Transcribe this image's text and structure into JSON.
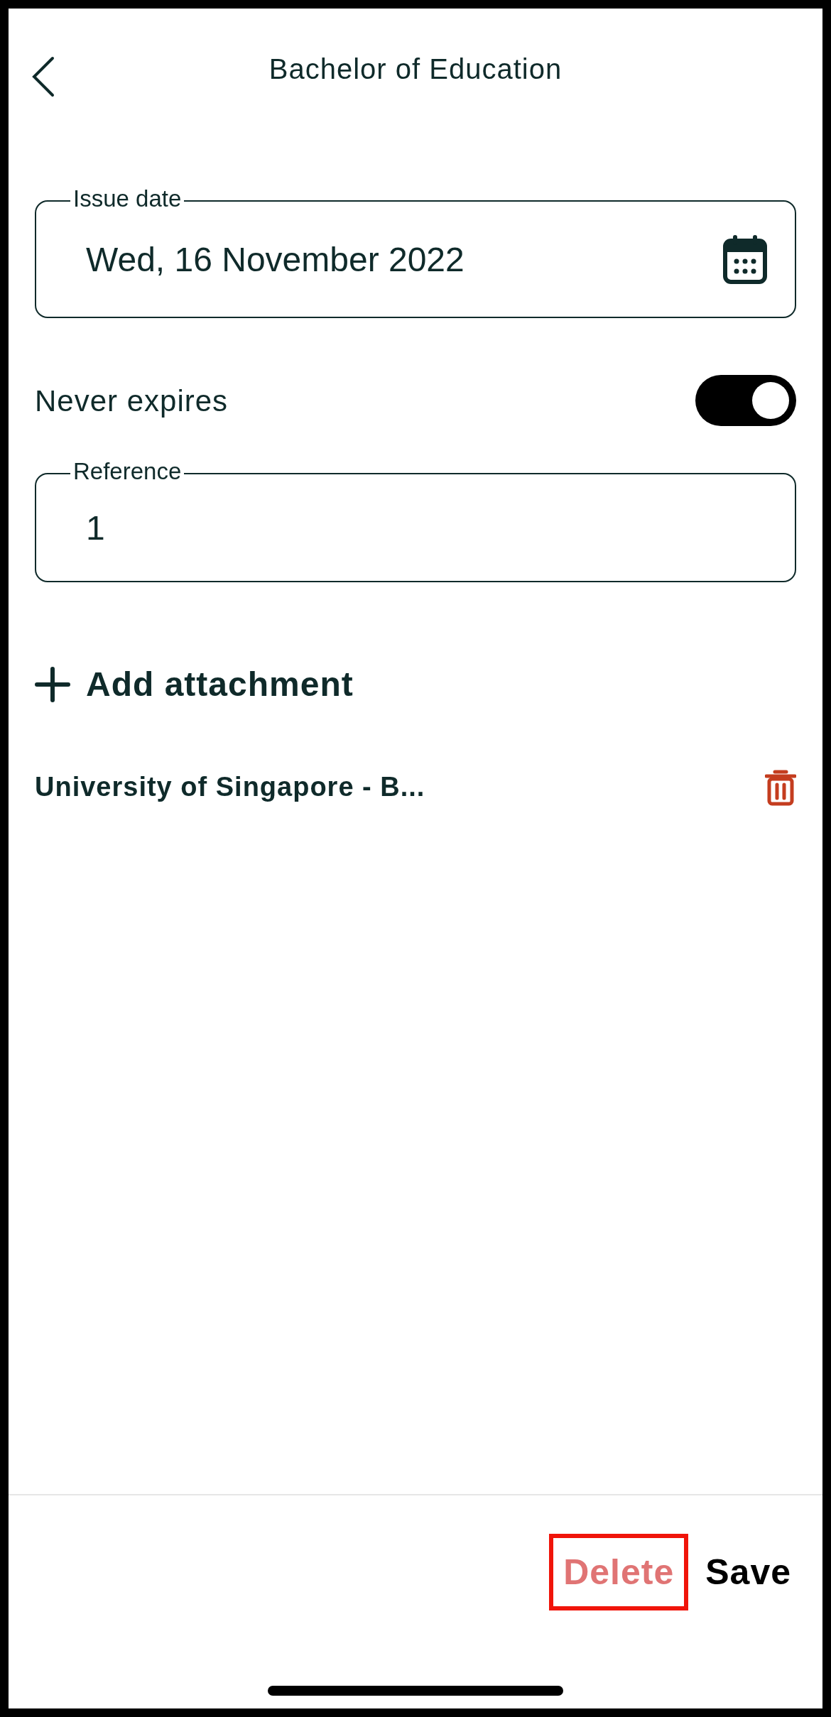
{
  "header": {
    "title": "Bachelor of Education"
  },
  "issue_date": {
    "label": "Issue date",
    "value": "Wed, 16 November 2022"
  },
  "never_expires": {
    "label": "Never expires",
    "on": true
  },
  "reference": {
    "label": "Reference",
    "value": "1"
  },
  "add_attachment": {
    "label": "Add attachment"
  },
  "attachments": [
    {
      "name": "University of Singapore - B..."
    }
  ],
  "footer": {
    "buttons": [
      {
        "label": "Delete",
        "kind": "danger",
        "highlighted": true
      },
      {
        "label": "Save",
        "kind": "primary",
        "highlighted": false
      }
    ]
  }
}
